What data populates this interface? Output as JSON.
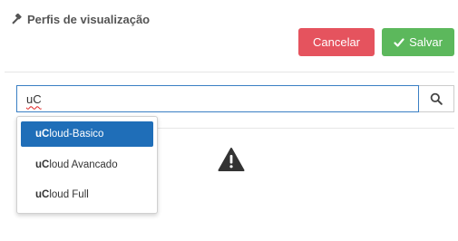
{
  "header": {
    "title": "Perfis de visualização",
    "title_icon": "gavel-icon"
  },
  "actions": {
    "cancel_label": "Cancelar",
    "save_label": "Salvar",
    "cancel_color": "#e5535e",
    "save_color": "#5cb85c"
  },
  "search": {
    "value": "uC",
    "button_icon": "search-icon"
  },
  "dropdown": {
    "items": [
      {
        "match": "uC",
        "rest": "loud-Basico",
        "selected": true
      },
      {
        "match": "uC",
        "rest": "loud Avancado",
        "selected": false
      },
      {
        "match": "uC",
        "rest": "loud Full",
        "selected": false
      }
    ]
  },
  "content": {
    "icon": "warning-icon"
  }
}
